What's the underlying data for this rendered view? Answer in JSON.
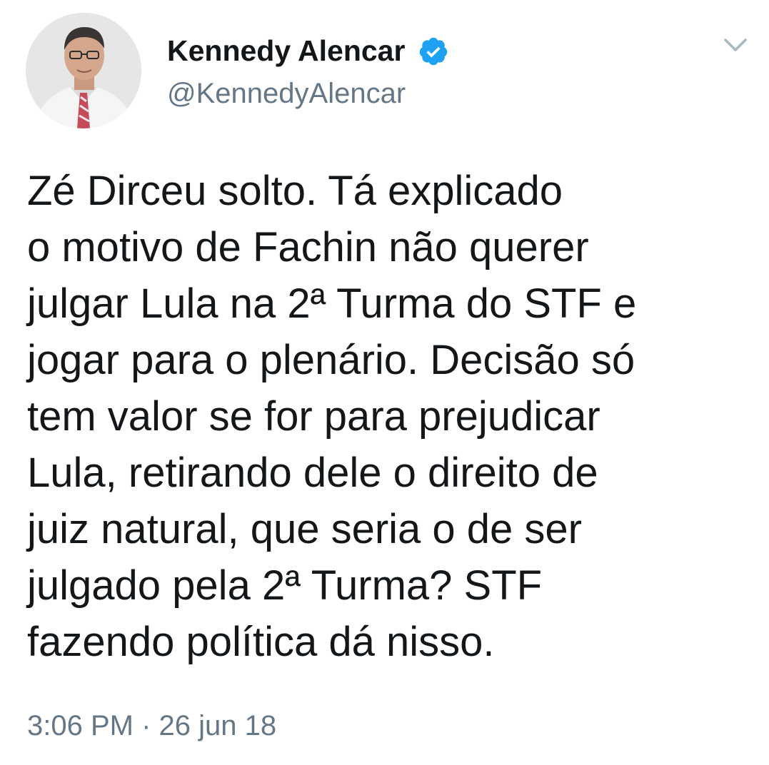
{
  "author": {
    "display_name": "Kennedy Alencar",
    "handle": "@KennedyAlencar",
    "verified": true
  },
  "tweet": {
    "lines": [
      "Zé Dirceu solto. Tá explicado",
      "o motivo de Fachin não querer",
      "julgar Lula na 2ª Turma do STF e",
      "jogar para o plenário. Decisão só",
      "tem valor se for para prejudicar",
      "Lula, retirando dele o direito de",
      "juiz natural, que seria o de ser",
      "julgado pela 2ª Turma? STF",
      "fazendo política dá nisso."
    ],
    "time": "3:06 PM",
    "separator": "·",
    "date": "26 jun 18"
  },
  "icons": {
    "verified": "verified-badge-icon",
    "menu": "chevron-down-icon"
  },
  "colors": {
    "verified_blue": "#1da1f2",
    "secondary_text": "#657786",
    "primary_text": "#14171a"
  }
}
